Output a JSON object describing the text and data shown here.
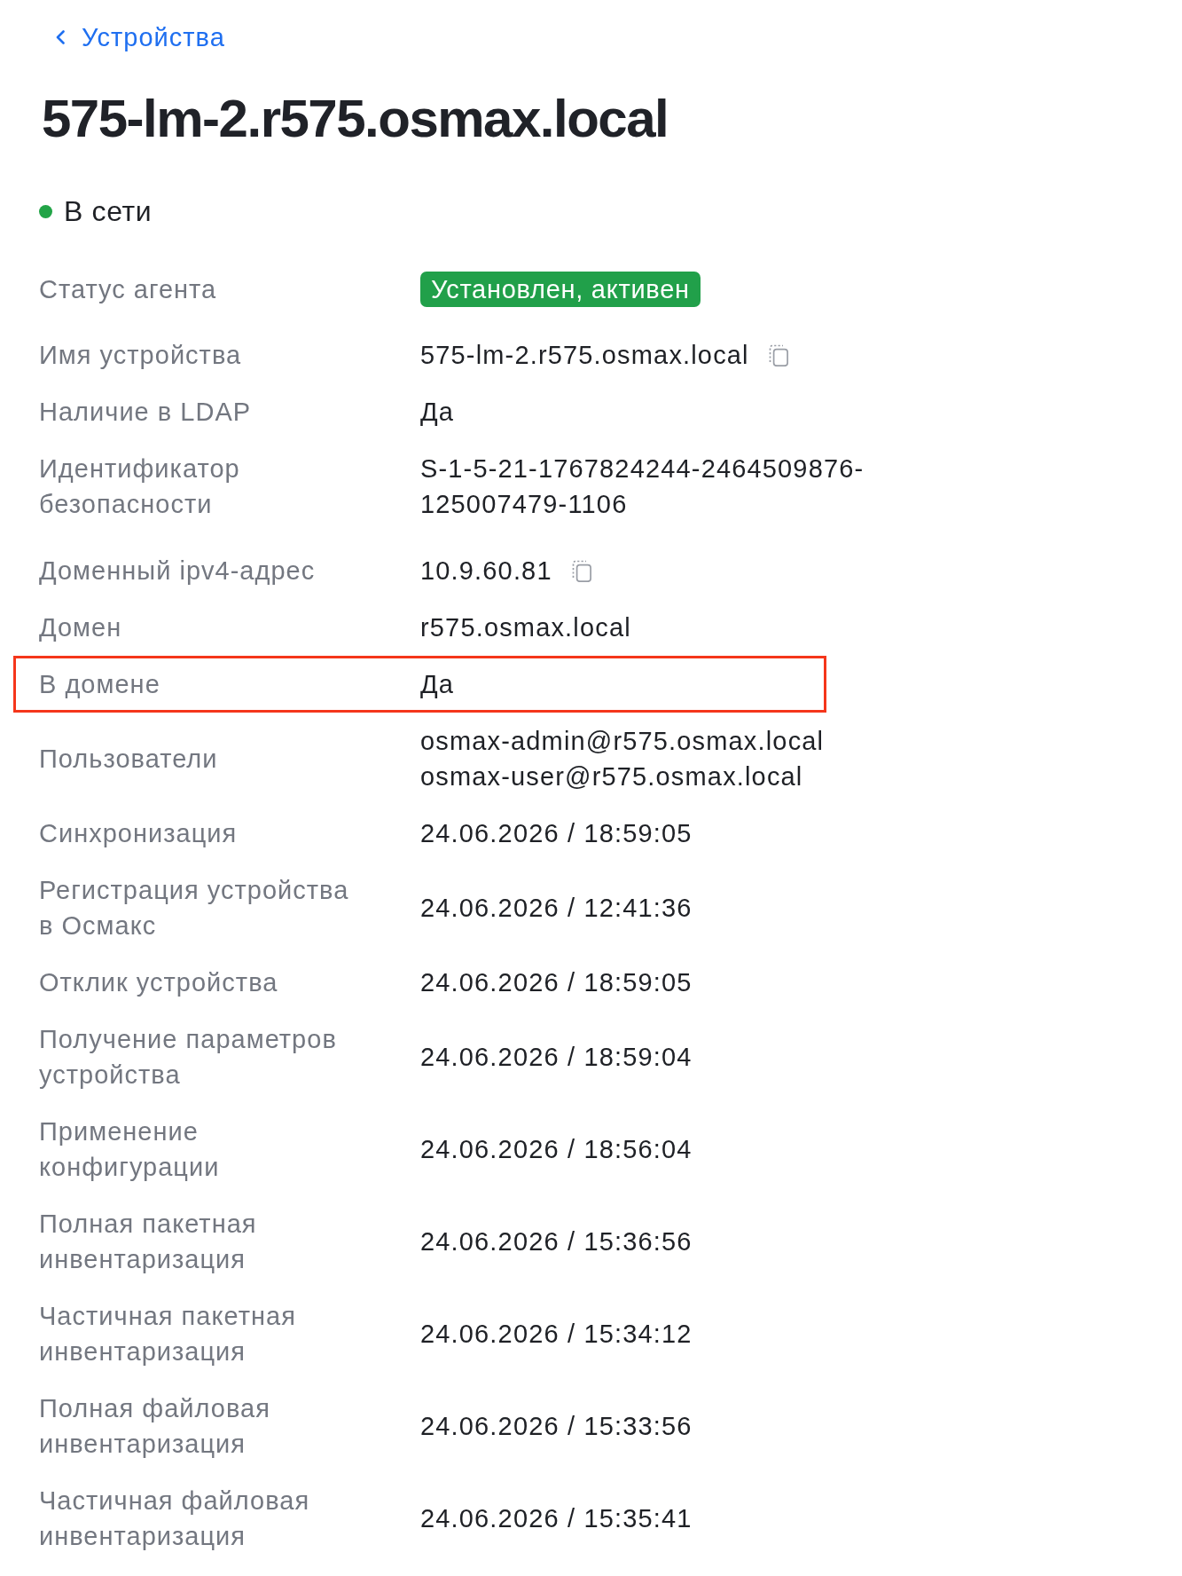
{
  "back_link": {
    "label": "Устройства"
  },
  "title": "575-lm-2.r575.osmax.local",
  "status": {
    "label": "В сети",
    "online": true
  },
  "rows": [
    {
      "kind": "badge",
      "label": "Статус агента",
      "value": "Установлен, активен",
      "active": true,
      "highlighted": false
    },
    {
      "kind": "copyable",
      "label": "Имя устройства",
      "value": "575-lm-2.r575.osmax.local",
      "highlighted": false
    },
    {
      "kind": "text",
      "label": "Наличие в LDAP",
      "value": "Да",
      "highlighted": false
    },
    {
      "kind": "wrapped",
      "label": "Идентификатор безопасности",
      "value": "S-1-5-21-1767824244-2464509876-125007479-1106",
      "highlighted": false
    },
    {
      "kind": "copyable",
      "label": "Доменный ipv4-адрес",
      "value": "10.9.60.81",
      "highlighted": false
    },
    {
      "kind": "text",
      "label": "Домен",
      "value": "r575.osmax.local",
      "highlighted": false
    },
    {
      "kind": "text",
      "label": "В домене",
      "value": "Да",
      "highlighted": true
    },
    {
      "kind": "list",
      "label": "Пользователи",
      "values": [
        "osmax-admin@r575.osmax.local",
        "osmax-user@r575.osmax.local"
      ],
      "highlighted": false
    },
    {
      "kind": "text",
      "label": "Синхронизация",
      "value": "24.06.2026 / 18:59:05",
      "highlighted": false
    },
    {
      "kind": "text",
      "label": "Регистрация устройства в Осмакс",
      "value": "24.06.2026 / 12:41:36",
      "highlighted": false
    },
    {
      "kind": "text",
      "label": "Отклик устройства",
      "value": "24.06.2026 / 18:59:05",
      "highlighted": false
    },
    {
      "kind": "text",
      "label": "Получение параметров устройства",
      "value": "24.06.2026 / 18:59:04",
      "highlighted": false
    },
    {
      "kind": "text",
      "label": "Применение конфигурации",
      "value": "24.06.2026 / 18:56:04",
      "highlighted": false
    },
    {
      "kind": "text",
      "label": "Полная пакетная инвентаризация",
      "value": "24.06.2026 / 15:36:56",
      "highlighted": false
    },
    {
      "kind": "text",
      "label": "Частичная пакетная инвентаризация",
      "value": "24.06.2026 / 15:34:12",
      "highlighted": false
    },
    {
      "kind": "text",
      "label": "Полная файловая инвентаризация",
      "value": "24.06.2026 / 15:33:56",
      "highlighted": false
    },
    {
      "kind": "text",
      "label": "Частичная файловая инвентаризация",
      "value": "24.06.2026 / 15:35:41",
      "highlighted": false
    }
  ]
}
